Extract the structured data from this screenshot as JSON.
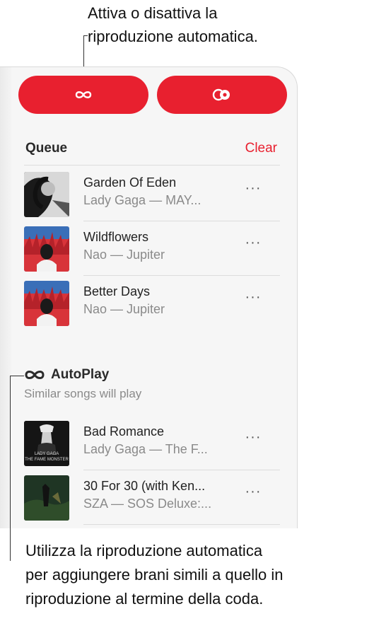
{
  "callouts": {
    "top_line1": "Attiva o disattiva la",
    "top_line2": "riproduzione automatica.",
    "bottom_line1": "Utilizza la riproduzione automatica",
    "bottom_line2": "per aggiungere brani simili a quello in",
    "bottom_line3": "riproduzione al termine della coda."
  },
  "toolbar": {
    "autoplay_icon": "infinity-icon",
    "history_icon": "overlapping-circles-icon",
    "accent": "#e8202f"
  },
  "queue": {
    "title": "Queue",
    "clear_label": "Clear",
    "items": [
      {
        "title": "Garden Of Eden",
        "subtitle": "Lady Gaga — MAY...",
        "more": "···"
      },
      {
        "title": "Wildflowers",
        "subtitle": "Nao — Jupiter",
        "more": "···"
      },
      {
        "title": "Better Days",
        "subtitle": "Nao — Jupiter",
        "more": "···"
      }
    ]
  },
  "autoplay": {
    "icon": "infinity-icon",
    "title": "AutoPlay",
    "subtitle": "Similar songs will play",
    "items": [
      {
        "title": "Bad Romance",
        "subtitle": "Lady Gaga — The F...",
        "more": "···",
        "art_text_1": "LADY GAGA",
        "art_text_2": "THE FAME MONSTER"
      },
      {
        "title": "30 For 30 (with Ken...",
        "subtitle": "SZA — SOS Deluxe:...",
        "more": "···"
      }
    ]
  }
}
